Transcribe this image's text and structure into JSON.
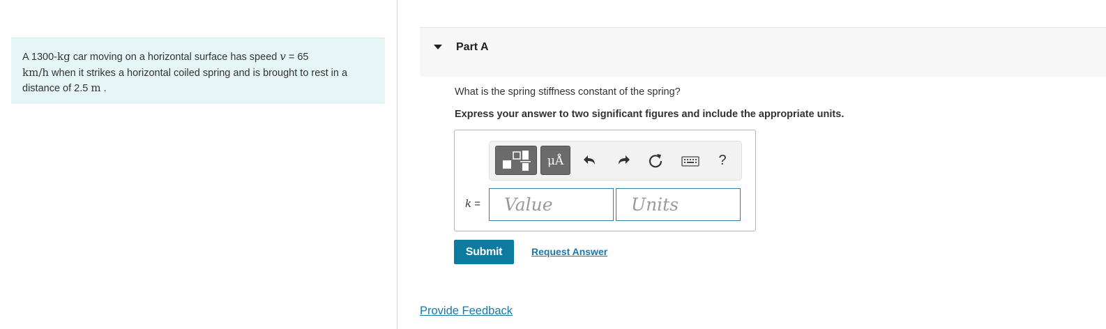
{
  "problem": {
    "t1": "A 1300-",
    "m_kg": "kg",
    "t2": " car moving on a horizontal surface has speed ",
    "v_sym": "v",
    "t3": " = 65",
    "m_kmh": "km/h",
    "t4": " when it strikes a horizontal coiled spring and is brought to rest in a distance of 2.5 ",
    "m_m": "m",
    "t5": " ."
  },
  "part": {
    "title": "Part A",
    "question": "What is the spring stiffness constant of the spring?",
    "instruction": "Express your answer to two significant figures and include the appropriate units."
  },
  "toolbar": {
    "units_label": "μÅ",
    "help_label": "?"
  },
  "answer": {
    "var_symbol": "k",
    "var_eq": " =",
    "value_placeholder": "Value",
    "units_placeholder": "Units"
  },
  "actions": {
    "submit_label": "Submit",
    "request_answer_label": "Request Answer",
    "feedback_label": "Provide Feedback"
  },
  "icons": {
    "caret": "caret-down-icon",
    "templates": "templates-icon",
    "undo": "undo-icon",
    "redo": "redo-icon",
    "reset": "reset-icon",
    "keyboard": "keyboard-icon"
  },
  "colors": {
    "accent": "#0d7aa0",
    "link": "#1c77a7",
    "problem_bg": "#e6f5f6"
  }
}
